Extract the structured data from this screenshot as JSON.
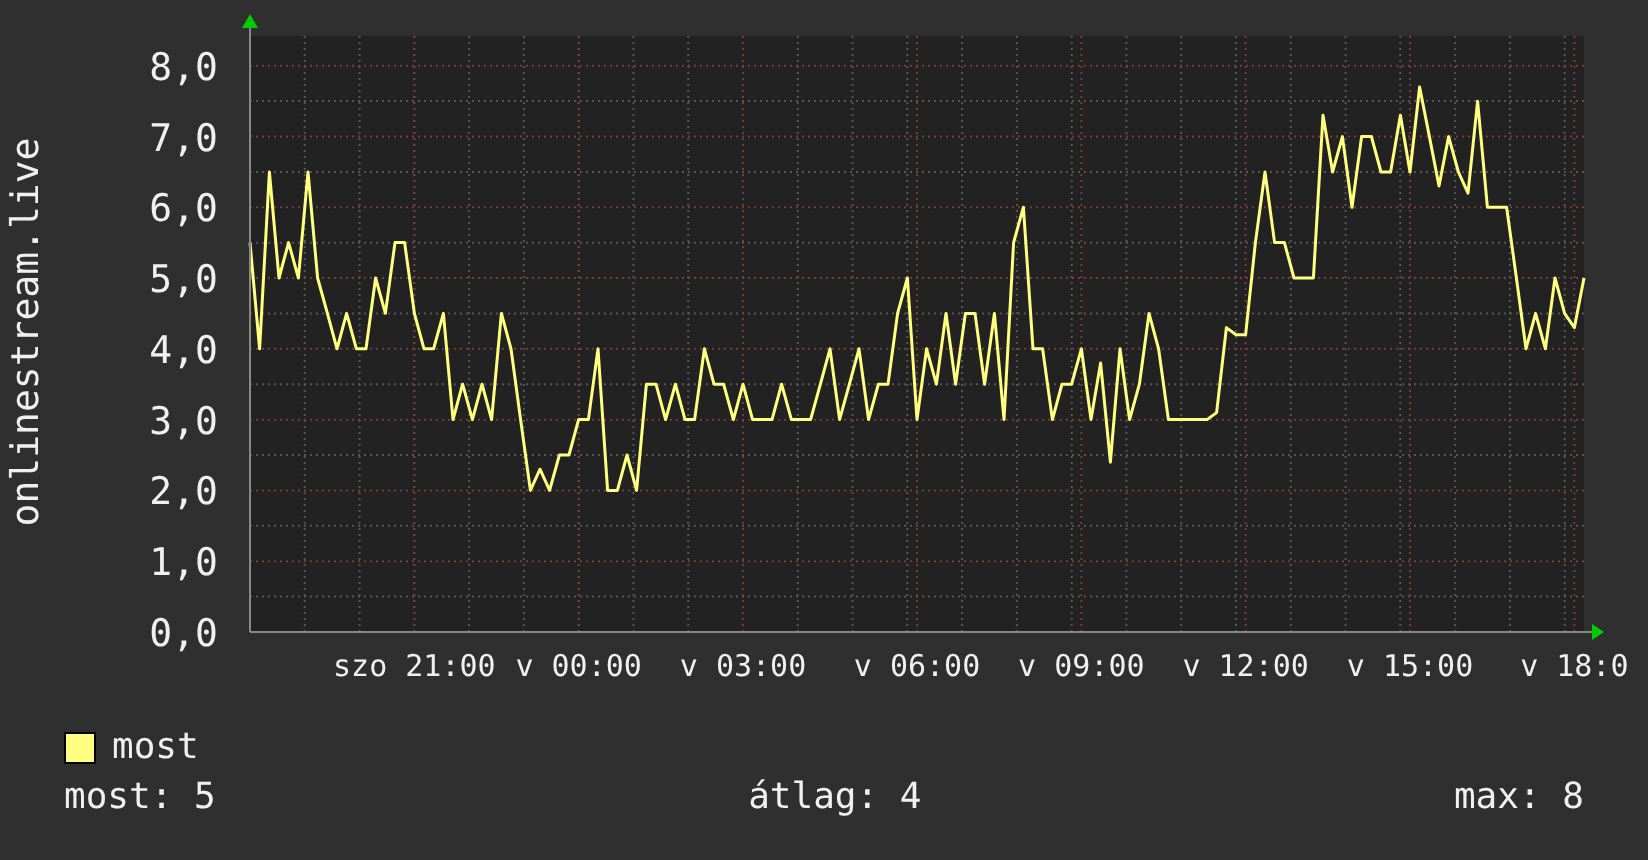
{
  "chart": {
    "chart_data": {
      "type": "line",
      "ylabel": "onlinestream.live",
      "grid": true,
      "ylim": [
        0,
        8.42
      ],
      "categories": [
        null,
        null,
        null,
        null,
        null,
        null,
        null,
        null,
        null,
        null,
        null,
        null,
        null,
        null,
        null,
        null,
        null,
        "szo 21:00",
        null,
        null,
        null,
        null,
        null,
        null,
        null,
        null,
        null,
        null,
        null,
        null,
        null,
        null,
        null,
        null,
        "v 00:00",
        null,
        null,
        null,
        null,
        null,
        null,
        null,
        null,
        null,
        null,
        null,
        null,
        null,
        null,
        null,
        null,
        "v 03:00",
        null,
        null,
        null,
        null,
        null,
        null,
        null,
        null,
        null,
        null,
        null,
        null,
        null,
        null,
        null,
        null,
        null,
        "v 06:00",
        null,
        null,
        null,
        null,
        null,
        null,
        null,
        null,
        null,
        null,
        null,
        null,
        null,
        null,
        null,
        null,
        "v 09:00",
        null,
        null,
        null,
        null,
        null,
        null,
        null,
        null,
        null,
        null,
        null,
        null,
        null,
        null,
        null,
        null,
        "v 12:00",
        null,
        null,
        null,
        null,
        null,
        null,
        null,
        null,
        null,
        null,
        null,
        null,
        null,
        null,
        null,
        null,
        "v 15:00",
        null,
        null,
        null,
        null,
        null,
        null,
        null,
        null,
        null,
        null,
        null,
        null,
        null,
        null,
        null,
        null,
        "v 18:0",
        null
      ],
      "yticks": [
        {
          "value": 0,
          "label": "0,0"
        },
        {
          "value": 1,
          "label": "1,0"
        },
        {
          "value": 2,
          "label": "2,0"
        },
        {
          "value": 3,
          "label": "3,0"
        },
        {
          "value": 4,
          "label": "4,0"
        },
        {
          "value": 5,
          "label": "5,0"
        },
        {
          "value": 6,
          "label": "6,0"
        },
        {
          "value": 7,
          "label": "7,0"
        },
        {
          "value": 8,
          "label": "8,0"
        }
      ],
      "series": [
        {
          "name": "most",
          "color": "#ffff80",
          "values": [
            5.5,
            4,
            6.5,
            5,
            5.5,
            5,
            6.5,
            5,
            4.5,
            4,
            4.5,
            4,
            4,
            5,
            4.5,
            5.5,
            5.5,
            4.5,
            4,
            4,
            4.5,
            3,
            3.5,
            3,
            3.5,
            3,
            4.5,
            4,
            3,
            2,
            2.3,
            2,
            2.5,
            2.5,
            3,
            3,
            4,
            2,
            2,
            2.5,
            2,
            3.5,
            3.5,
            3,
            3.5,
            3,
            3,
            4,
            3.5,
            3.5,
            3,
            3.5,
            3,
            3,
            3,
            3.5,
            3,
            3,
            3,
            3.5,
            4,
            3,
            3.5,
            4,
            3,
            3.5,
            3.5,
            4.5,
            5,
            3,
            4,
            3.5,
            4.5,
            3.5,
            4.5,
            4.5,
            3.5,
            4.5,
            3,
            5.5,
            6,
            4,
            4,
            3,
            3.5,
            3.5,
            4,
            3,
            3.8,
            2.4,
            4,
            3,
            3.5,
            4.5,
            4,
            3,
            3,
            3,
            3,
            3,
            3.1,
            4.3,
            4.2,
            4.2,
            5.5,
            6.5,
            5.5,
            5.5,
            5,
            5,
            5,
            7.3,
            6.5,
            7,
            6,
            7,
            7,
            6.5,
            6.5,
            7.3,
            6.5,
            7.7,
            7,
            6.3,
            7,
            6.5,
            6.2,
            7.5,
            6,
            6,
            6,
            5,
            4,
            4.5,
            4,
            5,
            4.5,
            4.3,
            5
          ]
        }
      ]
    }
  },
  "legend": {
    "stats": [
      "most: 5",
      "átlag: 4",
      "max: 8"
    ]
  }
}
